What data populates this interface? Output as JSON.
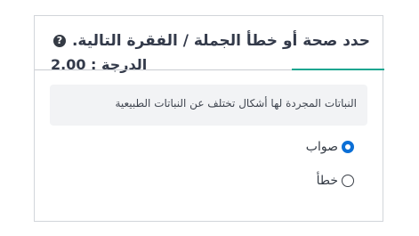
{
  "question": {
    "title": "حدد صحة أو خطأ الجملة / الفقرة التالية.",
    "grade_text": "الدرجة : 2.00",
    "help_icon": "question-circle-icon",
    "statement": "النباتات المجردة لها أشكال تختلف عن النباتات الطبيعية"
  },
  "options": [
    {
      "label": "صواب",
      "selected": true
    },
    {
      "label": "خطأ",
      "selected": false
    }
  ],
  "colors": {
    "accent": "#1aa690",
    "radio_selected": "#0b6fd6",
    "title_text": "#333a4a",
    "statement_bg": "#f2f3f5"
  }
}
